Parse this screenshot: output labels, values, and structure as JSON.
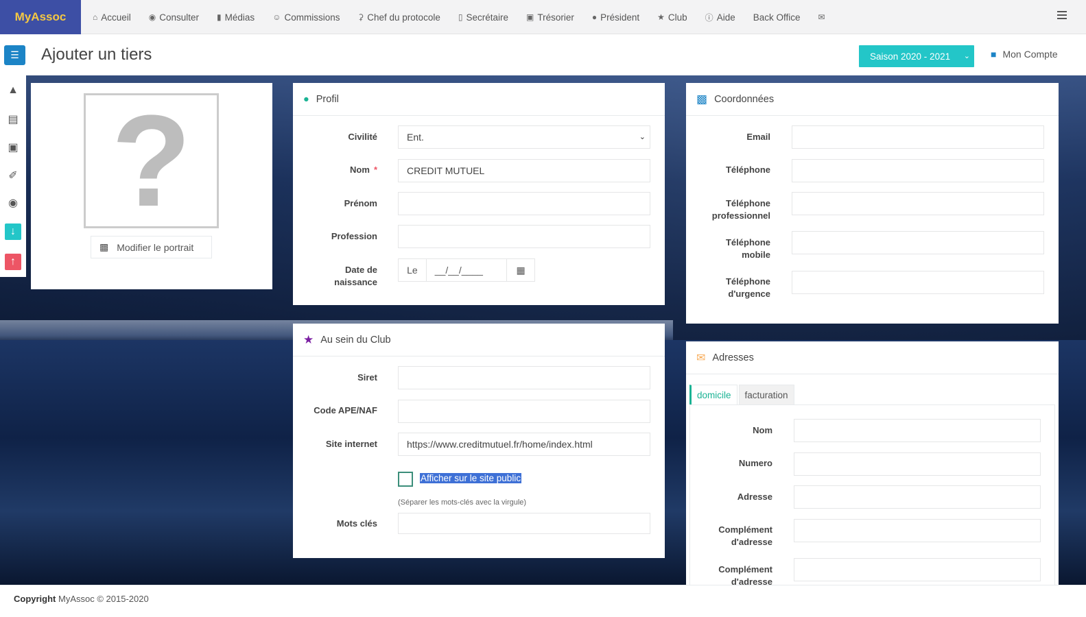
{
  "brand": "MyAssoc",
  "nav": [
    {
      "label": "Accueil",
      "icon": "home-icon"
    },
    {
      "label": "Consulter",
      "icon": "eye-icon"
    },
    {
      "label": "Médias",
      "icon": "file-icon"
    },
    {
      "label": "Commissions",
      "icon": "user-circle-icon"
    },
    {
      "label": "Chef du protocole",
      "icon": "trophy-icon"
    },
    {
      "label": "Secrétaire",
      "icon": "book-icon"
    },
    {
      "label": "Trésorier",
      "icon": "money-icon"
    },
    {
      "label": "Président",
      "icon": "globe-icon"
    },
    {
      "label": "Club",
      "icon": "star-icon"
    },
    {
      "label": "Aide",
      "icon": "info-icon"
    },
    {
      "label": "Back Office",
      "icon": ""
    },
    {
      "label": "",
      "icon": "envelope-icon"
    }
  ],
  "page_title": "Ajouter un tiers",
  "season": "Saison 2020 - 2021",
  "account": "Mon Compte",
  "portrait": {
    "button": "Modifier le portrait",
    "placeholder": "?"
  },
  "profil": {
    "title": "Profil",
    "civilite_label": "Civilité",
    "civilite_value": "Ent.",
    "nom_label": "Nom",
    "nom_required": "*",
    "nom_value": "CREDIT MUTUEL",
    "prenom_label": "Prénom",
    "profession_label": "Profession",
    "naissance_label_1": "Date de",
    "naissance_label_2": "naissance",
    "naissance_prefix": "Le",
    "naissance_placeholder": "__/__/____"
  },
  "club": {
    "title": "Au sein du Club",
    "siret_label": "Siret",
    "ape_label": "Code APE/NAF",
    "site_label": "Site internet",
    "site_value": "https://www.creditmutuel.fr/home/index.html",
    "afficher_label": "Afficher sur le site public",
    "hint": "(Séparer les mots-clés avec la virgule)",
    "mots_label": "Mots clés"
  },
  "coord": {
    "title": "Coordonnées",
    "email_label": "Email",
    "tel_label": "Téléphone",
    "telpro_label_1": "Téléphone",
    "telpro_label_2": "professionnel",
    "telmob_label_1": "Téléphone",
    "telmob_label_2": "mobile",
    "telurg_label_1": "Téléphone",
    "telurg_label_2": "d'urgence"
  },
  "adresses": {
    "title": "Adresses",
    "tabs": [
      "domicile",
      "facturation"
    ],
    "nom_label": "Nom",
    "numero_label": "Numero",
    "adresse_label": "Adresse",
    "comp1_label_1": "Complément",
    "comp1_label_2": "d'adresse",
    "comp2_label_1": "Complément",
    "comp2_label_2": "d'adresse"
  },
  "footer": {
    "bold": "Copyright",
    "text": " MyAssoc © 2015-2020"
  },
  "colors": {
    "brand_bg": "#3d4fa5",
    "brand_text": "#f5c842",
    "primary": "#1c84c6",
    "teal": "#23c6c8",
    "red": "#ed5565",
    "green": "#1ab394"
  }
}
